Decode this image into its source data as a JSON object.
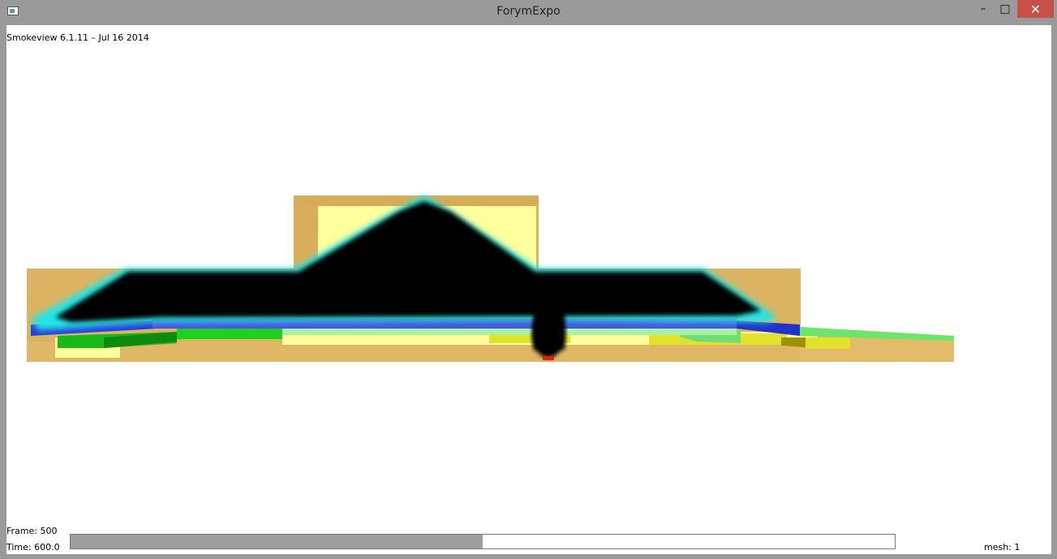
{
  "window": {
    "title": "ForymExpo",
    "minimize_label": "–",
    "maximize_label": "□",
    "close_label": "✕"
  },
  "viewer": {
    "version_text": "Smokeview 6.1.11 – Jul 16 2014",
    "frame_text": "Frame: 500",
    "time_text": "Time: 600.0",
    "mesh_text": "mesh: 1",
    "time_progress": 0.5
  },
  "colors": {
    "smoke": "#000000",
    "smoke_edge": "#22e5e5",
    "wall": "#dcb461",
    "panel": "#ffff9e",
    "blue_strip": "#2233cc",
    "green_block": "#1fd11f",
    "fire": "#e02010"
  }
}
